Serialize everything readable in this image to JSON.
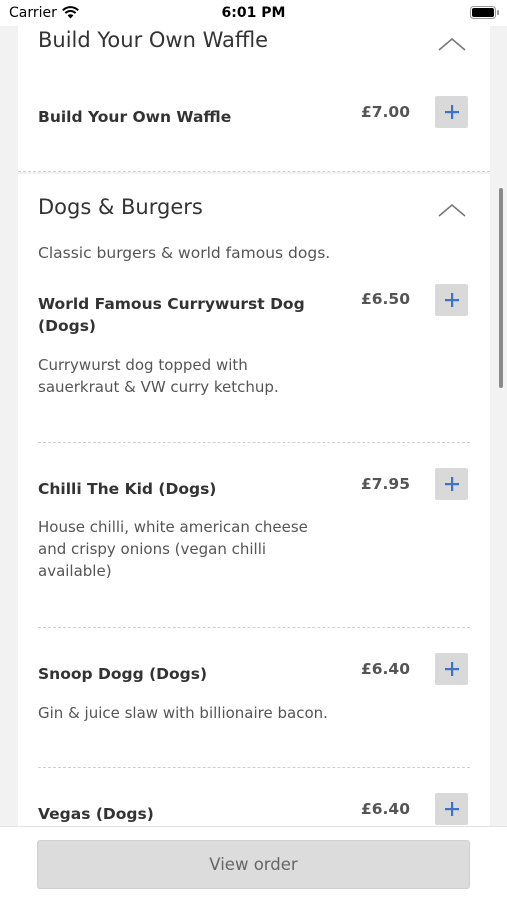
{
  "status_bar": {
    "carrier": "Carrier",
    "time": "6:01 PM"
  },
  "sections": {
    "waffle": {
      "title": "Build Your Own Waffle",
      "items": [
        {
          "name": "Build Your Own Waffle",
          "price": "£7.00"
        }
      ]
    },
    "dogs": {
      "title": "Dogs & Burgers",
      "description": "Classic burgers & world famous dogs.",
      "items": [
        {
          "name": "World Famous Currywurst Dog (Dogs)",
          "price": "£6.50",
          "description": "Currywurst dog topped with sauerkraut & VW curry ketchup."
        },
        {
          "name": "Chilli The Kid (Dogs)",
          "price": "£7.95",
          "description": "House chilli, white american cheese and crispy onions (vegan chilli available)"
        },
        {
          "name": "Snoop Dogg (Dogs)",
          "price": "£6.40",
          "description": "Gin & juice slaw with billionaire bacon."
        },
        {
          "name": "Vegas (Dogs)",
          "price": "£6.40"
        }
      ]
    }
  },
  "footer": {
    "view_order_label": "View order"
  },
  "colors": {
    "accent": "#3a73c7",
    "add_button_bg": "#d9d9d9",
    "background": "#f2f2f2"
  },
  "icons": {
    "add": "plus-icon",
    "collapse": "chevron-up-icon",
    "wifi": "wifi-icon",
    "battery": "battery-icon"
  }
}
